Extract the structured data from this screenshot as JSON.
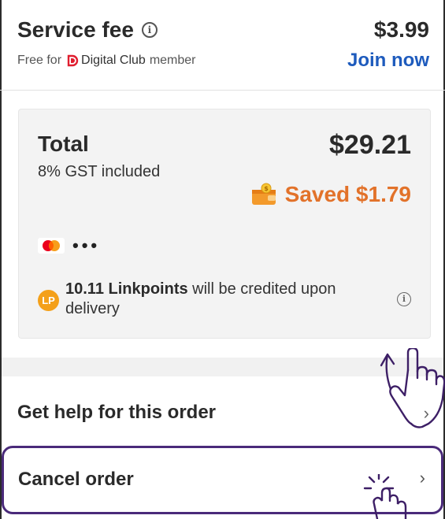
{
  "service_fee": {
    "title": "Service fee",
    "price": "$3.99",
    "free_prefix": "Free for",
    "club_name": "Digital Club",
    "member_suffix": "member",
    "join_label": "Join now"
  },
  "total": {
    "label": "Total",
    "amount": "$29.21",
    "gst_note": "8% GST included",
    "saved_text": "Saved $1.79",
    "masked_card": "•••"
  },
  "linkpoints": {
    "badge": "LP",
    "amount_text": "10.11 Linkpoints",
    "rest_text": " will be credited upon delivery"
  },
  "actions": {
    "help_label": "Get help for this order",
    "cancel_label": "Cancel order",
    "chevron": "›"
  },
  "colors": {
    "accent_blue": "#1e5bbd",
    "saved_orange": "#e2722a",
    "highlight_purple": "#4a2a7a",
    "lp_yellow": "#f4a01a"
  },
  "icons": [
    "info-icon",
    "digital-club-logo",
    "wallet-icon",
    "mastercard-icon",
    "linkpoints-badge",
    "chevron-right-icon",
    "swipe-up-hand-icon",
    "tap-hand-icon"
  ]
}
